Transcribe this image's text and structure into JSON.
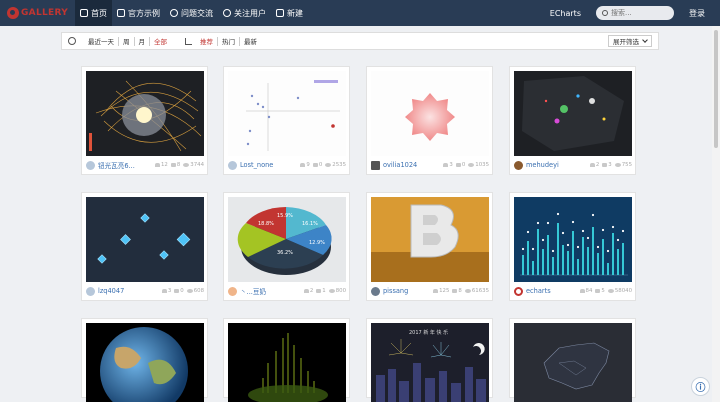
{
  "nav": {
    "logo_text": "GALLERY",
    "items": [
      {
        "label": "首页",
        "icon": "home-icon"
      },
      {
        "label": "官方示例",
        "icon": "check-square-icon"
      },
      {
        "label": "问题交流",
        "icon": "question-icon"
      },
      {
        "label": "关注用户",
        "icon": "eye-icon"
      },
      {
        "label": "新建",
        "icon": "edit-icon"
      }
    ],
    "echarts_link": "ECharts",
    "search_placeholder": "搜索...",
    "login": "登录"
  },
  "filter": {
    "time_options": [
      "最近一天",
      "周",
      "月",
      "全部"
    ],
    "sort_options": [
      "推荐",
      "热门",
      "最新"
    ],
    "expand_label": "展开筛选"
  },
  "cards": [
    {
      "user": "钮光瓦亮6...",
      "likes": "12",
      "comments": "8",
      "views": "3744"
    },
    {
      "user": "Lost_none",
      "likes": "9",
      "comments": "0",
      "views": "2535"
    },
    {
      "user": "ovilia1024",
      "likes": "3",
      "comments": "0",
      "views": "1035"
    },
    {
      "user": "mehudeyi",
      "likes": "2",
      "comments": "3",
      "views": "755"
    },
    {
      "user": "lzq4047",
      "likes": "3",
      "comments": "0",
      "views": "608"
    },
    {
      "user": "丶...豆奶",
      "likes": "2",
      "comments": "1",
      "views": "800"
    },
    {
      "user": "pissang",
      "likes": "125",
      "comments": "8",
      "views": "61635"
    },
    {
      "user": "echarts",
      "likes": "84",
      "comments": "5",
      "views": "58040"
    },
    {
      "user": "",
      "likes": "",
      "comments": "",
      "views": ""
    },
    {
      "user": "",
      "likes": "",
      "comments": "",
      "views": ""
    },
    {
      "user": "",
      "likes": "",
      "comments": "",
      "views": ""
    },
    {
      "user": "",
      "likes": "",
      "comments": "",
      "views": ""
    }
  ],
  "pie_labels": [
    "15.9%",
    "16.1%",
    "18.8%",
    "12.9%",
    "36.2%"
  ],
  "fireworks_title": "2017  新 年 快 乐",
  "help_icon": "ⓘ",
  "colors": {
    "nav_bg": "#293c55",
    "brand_red": "#c23531",
    "link_blue": "#3a6fb0"
  }
}
